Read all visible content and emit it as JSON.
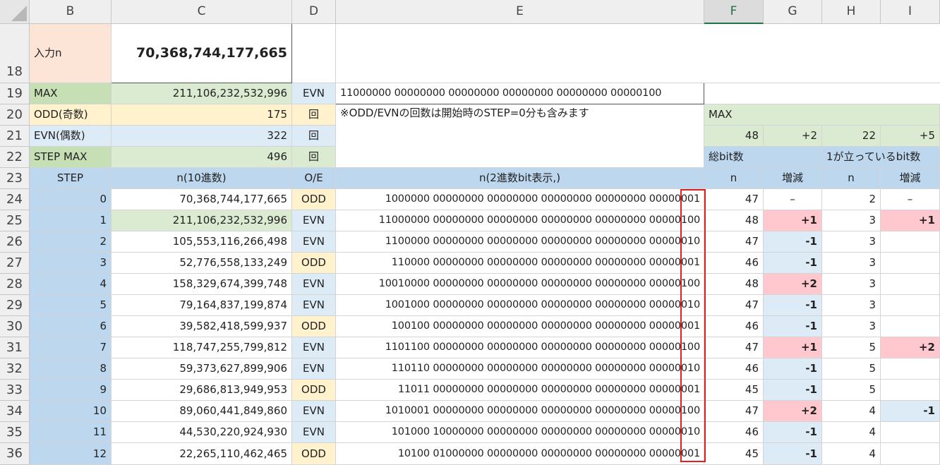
{
  "columns": [
    "B",
    "C",
    "D",
    "E",
    "F",
    "G",
    "H",
    "I"
  ],
  "rows": [
    "18",
    "19",
    "20",
    "21",
    "22",
    "23",
    "24",
    "25",
    "26",
    "27",
    "28",
    "29",
    "30",
    "31",
    "32",
    "33",
    "34",
    "35",
    "36"
  ],
  "top": {
    "input_label": "入力n",
    "input_value": "70,368,744,177,665",
    "max_label": "MAX",
    "max_value": "211,106,232,532,996",
    "max_oe": "EVN",
    "max_binary": "11000000 00000000 00000000 00000000 00000000 00000100",
    "odd_label": "ODD(奇数)",
    "odd_value": "175",
    "odd_unit": "回",
    "evn_label": "EVN(偶数)",
    "evn_value": "322",
    "evn_unit": "回",
    "stepmax_label": "STEP MAX",
    "stepmax_value": "496",
    "stepmax_unit": "回",
    "note": "※ODD/EVNの回数は開始時のSTEP=0分も含みます",
    "max_section_label": "MAX",
    "max_bits_n": "48",
    "max_bits_delta": "+2",
    "max_ones_n": "22",
    "max_ones_delta": "+5",
    "total_bits_label": "総bit数",
    "ones_label": "1が立っているbit数"
  },
  "headers": {
    "step": "STEP",
    "n10": "n(10進数)",
    "oe": "O/E",
    "n2": "n(2進数bit表示,)",
    "n": "n",
    "delta": "増減",
    "n_b": "n",
    "delta_b": "増減"
  },
  "table": [
    {
      "step": "0",
      "n10": "70,368,744,177,665",
      "oe": "ODD",
      "bin": "1000000 00000000 00000000 00000000 00000000 00000001",
      "bits": "47",
      "bd": "–",
      "ones": "2",
      "od": "–"
    },
    {
      "step": "1",
      "n10": "211,106,232,532,996",
      "oe": "EVN",
      "bin": "11000000 00000000 00000000 00000000 00000000 00000100",
      "bits": "48",
      "bd": "+1",
      "ones": "3",
      "od": "+1"
    },
    {
      "step": "2",
      "n10": "105,553,116,266,498",
      "oe": "EVN",
      "bin": "1100000 00000000 00000000 00000000 00000000 00000010",
      "bits": "47",
      "bd": "-1",
      "ones": "3",
      "od": ""
    },
    {
      "step": "3",
      "n10": "52,776,558,133,249",
      "oe": "ODD",
      "bin": "110000 00000000 00000000 00000000 00000000 00000001",
      "bits": "46",
      "bd": "-1",
      "ones": "3",
      "od": ""
    },
    {
      "step": "4",
      "n10": "158,329,674,399,748",
      "oe": "EVN",
      "bin": "10010000 00000000 00000000 00000000 00000000 00000100",
      "bits": "48",
      "bd": "+2",
      "ones": "3",
      "od": ""
    },
    {
      "step": "5",
      "n10": "79,164,837,199,874",
      "oe": "EVN",
      "bin": "1001000 00000000 00000000 00000000 00000000 00000010",
      "bits": "47",
      "bd": "-1",
      "ones": "3",
      "od": ""
    },
    {
      "step": "6",
      "n10": "39,582,418,599,937",
      "oe": "ODD",
      "bin": "100100 00000000 00000000 00000000 00000000 00000001",
      "bits": "46",
      "bd": "-1",
      "ones": "3",
      "od": ""
    },
    {
      "step": "7",
      "n10": "118,747,255,799,812",
      "oe": "EVN",
      "bin": "1101100 00000000 00000000 00000000 00000000 00000100",
      "bits": "47",
      "bd": "+1",
      "ones": "5",
      "od": "+2"
    },
    {
      "step": "8",
      "n10": "59,373,627,899,906",
      "oe": "EVN",
      "bin": "110110 00000000 00000000 00000000 00000000 00000010",
      "bits": "46",
      "bd": "-1",
      "ones": "5",
      "od": ""
    },
    {
      "step": "9",
      "n10": "29,686,813,949,953",
      "oe": "ODD",
      "bin": "11011 00000000 00000000 00000000 00000000 00000001",
      "bits": "45",
      "bd": "-1",
      "ones": "5",
      "od": ""
    },
    {
      "step": "10",
      "n10": "89,060,441,849,860",
      "oe": "EVN",
      "bin": "1010001 00000000 00000000 00000000 00000000 00000100",
      "bits": "47",
      "bd": "+2",
      "ones": "4",
      "od": "-1"
    },
    {
      "step": "11",
      "n10": "44,530,220,924,930",
      "oe": "EVN",
      "bin": "101000 10000000 00000000 00000000 00000000 00000010",
      "bits": "46",
      "bd": "-1",
      "ones": "4",
      "od": ""
    },
    {
      "step": "12",
      "n10": "22,265,110,462,465",
      "oe": "ODD",
      "bin": "10100 01000000 00000000 00000000 00000000 00000001",
      "bits": "45",
      "bd": "-1",
      "ones": "4",
      "od": ""
    }
  ],
  "colors": {
    "sheet_green": "#dbebd1",
    "sheet_yellow": "#fff2cc",
    "sheet_blue": "#ddebf7",
    "sheet_blue_dark": "#bdd7ee",
    "sheet_peach": "#fce4d6",
    "sheet_pink": "#ffc7ce",
    "highlight_box": "#e02020",
    "selected_header": "#217346"
  }
}
